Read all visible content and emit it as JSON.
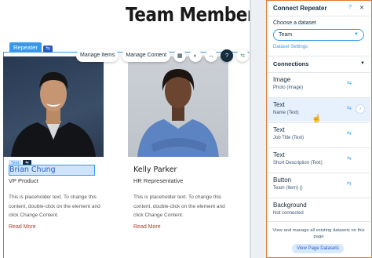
{
  "canvas": {
    "page_title": "Team Members",
    "repeater_tag": "Repeater",
    "text_tag": "Text"
  },
  "toolbar": {
    "manage_items": "Manage Items",
    "manage_content": "Manage Content"
  },
  "team": [
    {
      "name": "Brian Chung",
      "title": "VP Product",
      "description": "This is placeholder text. To change this content, double-click on the element and click Change Content.",
      "link": "Read More"
    },
    {
      "name": "Kelly Parker",
      "title": "HR Representative",
      "description": "This is placeholder text. To change this content, double-click on the element and click Change Content.",
      "link": "Read More"
    }
  ],
  "panel": {
    "title": "Connect Repeater",
    "dataset_label": "Choose a dataset",
    "dataset_value": "Team",
    "dataset_settings": "Dataset Settings",
    "connections_title": "Connections",
    "connections": [
      {
        "label": "Image",
        "sub": "Photo (Image)"
      },
      {
        "label": "Text",
        "sub": "Name (Text)"
      },
      {
        "label": "Text",
        "sub": "Job Title (Text)"
      },
      {
        "label": "Text",
        "sub": "Short Description (Text)"
      },
      {
        "label": "Button",
        "sub": "Team (Item) ()"
      },
      {
        "label": "Background",
        "sub": "Not connected"
      }
    ],
    "manage_text": "View and manage all existing datasets on this page",
    "view_datasets": "View Page Datasets"
  },
  "colors": {
    "accent": "#3899ec",
    "panel_border": "#e8762d",
    "link_red": "#b33a2e"
  }
}
